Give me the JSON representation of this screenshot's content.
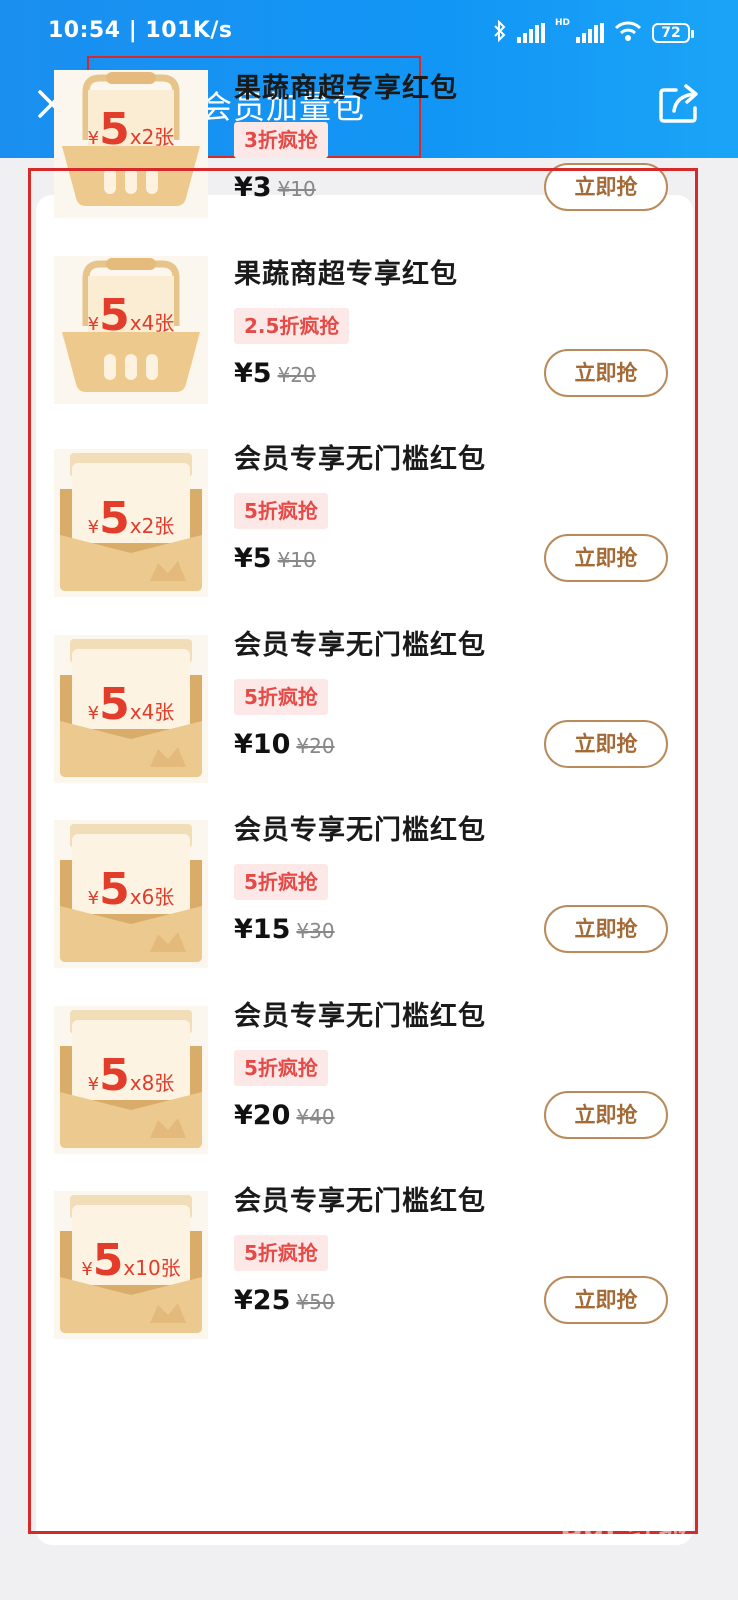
{
  "status_bar": {
    "time": "10:54",
    "network_speed": "101K/s",
    "signal_hd_label": "HD",
    "battery": "72"
  },
  "header": {
    "title": "超级会员加量包"
  },
  "products": [
    {
      "name": "果蔬商超专享红包",
      "discount": "3折疯抢",
      "price": "¥3",
      "original_price": "¥10",
      "cta": "立即抢",
      "thumb": {
        "style": "basket",
        "currency": "¥",
        "amount": "5",
        "count": "x2张"
      }
    },
    {
      "name": "果蔬商超专享红包",
      "discount": "2.5折疯抢",
      "price": "¥5",
      "original_price": "¥20",
      "cta": "立即抢",
      "thumb": {
        "style": "basket",
        "currency": "¥",
        "amount": "5",
        "count": "x4张"
      }
    },
    {
      "name": "会员专享无门槛红包",
      "discount": "5折疯抢",
      "price": "¥5",
      "original_price": "¥10",
      "cta": "立即抢",
      "thumb": {
        "style": "envelope",
        "currency": "¥",
        "amount": "5",
        "count": "x2张"
      }
    },
    {
      "name": "会员专享无门槛红包",
      "discount": "5折疯抢",
      "price": "¥10",
      "original_price": "¥20",
      "cta": "立即抢",
      "thumb": {
        "style": "envelope",
        "currency": "¥",
        "amount": "5",
        "count": "x4张"
      }
    },
    {
      "name": "会员专享无门槛红包",
      "discount": "5折疯抢",
      "price": "¥15",
      "original_price": "¥30",
      "cta": "立即抢",
      "thumb": {
        "style": "envelope",
        "currency": "¥",
        "amount": "5",
        "count": "x6张"
      }
    },
    {
      "name": "会员专享无门槛红包",
      "discount": "5折疯抢",
      "price": "¥20",
      "original_price": "¥40",
      "cta": "立即抢",
      "thumb": {
        "style": "envelope",
        "currency": "¥",
        "amount": "5",
        "count": "x8张"
      }
    },
    {
      "name": "会员专享无门槛红包",
      "discount": "5折疯抢",
      "price": "¥25",
      "original_price": "¥50",
      "cta": "立即抢",
      "thumb": {
        "style": "envelope",
        "currency": "¥",
        "amount": "5",
        "count": "x10张"
      }
    }
  ],
  "watermark": "Bai 经验",
  "colors": {
    "header_bg": "#1296f5",
    "highlight_border": "#d62a2a",
    "tag_bg": "#fde8e8",
    "tag_text": "#e54a46",
    "button_border": "#b98a5a",
    "button_text": "#a46a36",
    "thumb_gold": "#e9c98f",
    "thumb_amount": "#e23c2a"
  }
}
